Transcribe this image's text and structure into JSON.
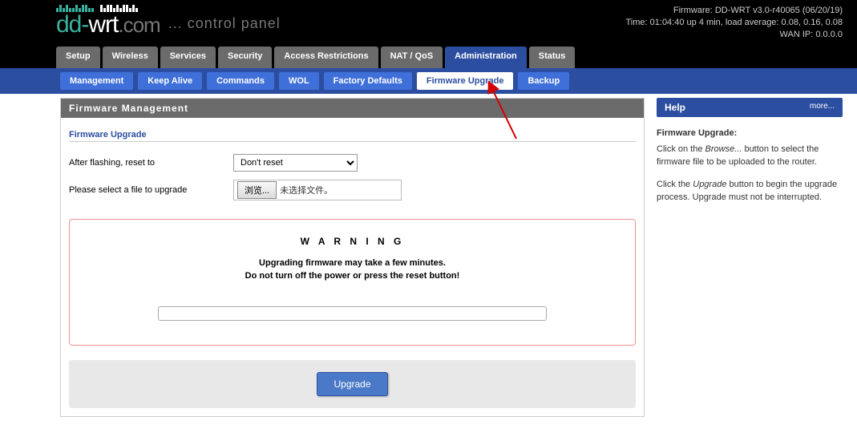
{
  "header": {
    "logo_main": "dd-wrt",
    "logo_suffix": ".com",
    "controlpanel": "... control panel",
    "firmware_line": "Firmware: DD-WRT v3.0-r40065 (06/20/19)",
    "time_line": "Time: 01:04:40 up 4 min, load average: 0.08, 0.16, 0.08",
    "wan_line": "WAN IP: 0.0.0.0"
  },
  "main_tabs": [
    "Setup",
    "Wireless",
    "Services",
    "Security",
    "Access Restrictions",
    "NAT / QoS",
    "Administration",
    "Status"
  ],
  "main_tab_active": "Administration",
  "sub_tabs": [
    "Management",
    "Keep Alive",
    "Commands",
    "WOL",
    "Factory Defaults",
    "Firmware Upgrade",
    "Backup"
  ],
  "sub_tab_active": "Firmware Upgrade",
  "section_title": "Firmware Management",
  "fieldset_title": "Firmware Upgrade",
  "form": {
    "after_flash_label": "After flashing, reset to",
    "after_flash_value": "Don't reset",
    "select_file_label": "Please select a file to upgrade",
    "browse_btn": "浏览...",
    "no_file_text": "未选择文件。"
  },
  "warning": {
    "title": "W A R N I N G",
    "line1": "Upgrading firmware may take a few minutes.",
    "line2": "Do not turn off the power or press the reset button!"
  },
  "upgrade_btn": "Upgrade",
  "help": {
    "title": "Help",
    "more": "more...",
    "h1": "Firmware Upgrade:",
    "p1a": "Click on the ",
    "p1b": "Browse...",
    "p1c": " button to select the firmware file to be uploaded to the router.",
    "p2a": "Click the ",
    "p2b": "Upgrade",
    "p2c": " button to begin the upgrade process. Upgrade must not be interrupted."
  }
}
